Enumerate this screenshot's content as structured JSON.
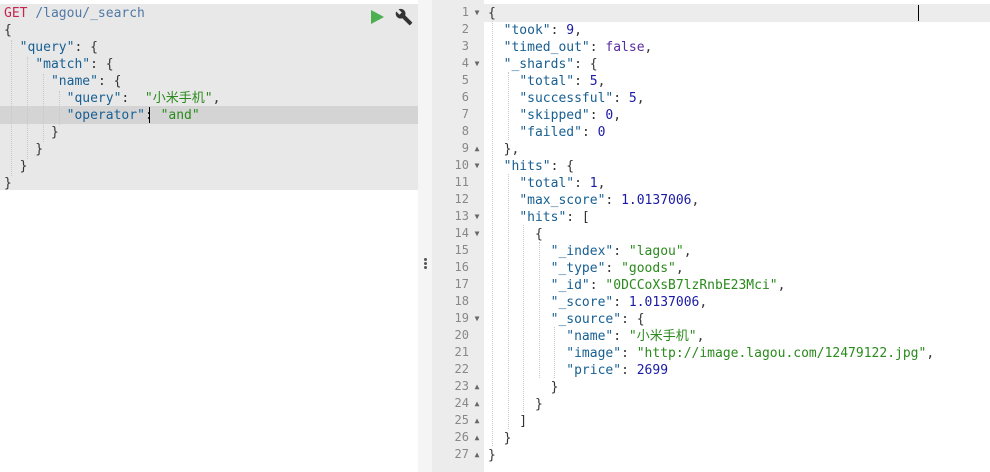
{
  "request": {
    "method": "GET",
    "path": "/lagou/_search",
    "lines": [
      [
        {
          "t": "{"
        }
      ],
      [
        {
          "t": "  "
        },
        {
          "t": "\"query\"",
          "c": "k"
        },
        {
          "t": ": {"
        }
      ],
      [
        {
          "t": "    "
        },
        {
          "t": "\"match\"",
          "c": "k"
        },
        {
          "t": ": {"
        }
      ],
      [
        {
          "t": "      "
        },
        {
          "t": "\"name\"",
          "c": "k"
        },
        {
          "t": ": {"
        }
      ],
      [
        {
          "t": "        "
        },
        {
          "t": "\"query\"",
          "c": "k"
        },
        {
          "t": ":  "
        },
        {
          "t": "\"小米手机\"",
          "c": "s"
        },
        {
          "t": ","
        }
      ],
      [
        {
          "t": "        "
        },
        {
          "t": "\"operator\"",
          "c": "k"
        },
        {
          "t": ": "
        },
        {
          "t": "\"and\"",
          "c": "s"
        }
      ],
      [
        {
          "t": "      }"
        }
      ],
      [
        {
          "t": "    }"
        }
      ],
      [
        {
          "t": "  }"
        }
      ],
      [
        {
          "t": "}"
        }
      ]
    ]
  },
  "toolbar": {
    "run_icon": "play-icon",
    "run_color": "#4caf50",
    "settings_icon": "wrench-icon"
  },
  "response": {
    "line_numbers": [
      "1",
      "2",
      "3",
      "4",
      "5",
      "6",
      "7",
      "8",
      "9",
      "10",
      "11",
      "12",
      "13",
      "14",
      "15",
      "16",
      "17",
      "18",
      "19",
      "20",
      "21",
      "22",
      "23",
      "24",
      "25",
      "26",
      "27"
    ],
    "folds": [
      "down",
      "",
      "",
      "down",
      "",
      "",
      "",
      "",
      "up",
      "down",
      "",
      "",
      "down",
      "down",
      "",
      "",
      "",
      "",
      "down",
      "",
      "",
      "",
      "up",
      "up",
      "up",
      "up",
      "up"
    ],
    "lines": [
      [
        {
          "t": "{"
        }
      ],
      [
        {
          "t": "  "
        },
        {
          "t": "\"took\"",
          "c": "k"
        },
        {
          "t": ": "
        },
        {
          "t": "9",
          "c": "n"
        },
        {
          "t": ","
        }
      ],
      [
        {
          "t": "  "
        },
        {
          "t": "\"timed_out\"",
          "c": "k"
        },
        {
          "t": ": "
        },
        {
          "t": "false",
          "c": "b"
        },
        {
          "t": ","
        }
      ],
      [
        {
          "t": "  "
        },
        {
          "t": "\"_shards\"",
          "c": "k"
        },
        {
          "t": ": {"
        }
      ],
      [
        {
          "t": "    "
        },
        {
          "t": "\"total\"",
          "c": "k"
        },
        {
          "t": ": "
        },
        {
          "t": "5",
          "c": "n"
        },
        {
          "t": ","
        }
      ],
      [
        {
          "t": "    "
        },
        {
          "t": "\"successful\"",
          "c": "k"
        },
        {
          "t": ": "
        },
        {
          "t": "5",
          "c": "n"
        },
        {
          "t": ","
        }
      ],
      [
        {
          "t": "    "
        },
        {
          "t": "\"skipped\"",
          "c": "k"
        },
        {
          "t": ": "
        },
        {
          "t": "0",
          "c": "n"
        },
        {
          "t": ","
        }
      ],
      [
        {
          "t": "    "
        },
        {
          "t": "\"failed\"",
          "c": "k"
        },
        {
          "t": ": "
        },
        {
          "t": "0",
          "c": "n"
        }
      ],
      [
        {
          "t": "  },"
        }
      ],
      [
        {
          "t": "  "
        },
        {
          "t": "\"hits\"",
          "c": "k"
        },
        {
          "t": ": {"
        }
      ],
      [
        {
          "t": "    "
        },
        {
          "t": "\"total\"",
          "c": "k"
        },
        {
          "t": ": "
        },
        {
          "t": "1",
          "c": "n"
        },
        {
          "t": ","
        }
      ],
      [
        {
          "t": "    "
        },
        {
          "t": "\"max_score\"",
          "c": "k"
        },
        {
          "t": ": "
        },
        {
          "t": "1.0137006",
          "c": "n"
        },
        {
          "t": ","
        }
      ],
      [
        {
          "t": "    "
        },
        {
          "t": "\"hits\"",
          "c": "k"
        },
        {
          "t": ": ["
        }
      ],
      [
        {
          "t": "      {"
        }
      ],
      [
        {
          "t": "        "
        },
        {
          "t": "\"_index\"",
          "c": "k"
        },
        {
          "t": ": "
        },
        {
          "t": "\"lagou\"",
          "c": "s"
        },
        {
          "t": ","
        }
      ],
      [
        {
          "t": "        "
        },
        {
          "t": "\"_type\"",
          "c": "k"
        },
        {
          "t": ": "
        },
        {
          "t": "\"goods\"",
          "c": "s"
        },
        {
          "t": ","
        }
      ],
      [
        {
          "t": "        "
        },
        {
          "t": "\"_id\"",
          "c": "k"
        },
        {
          "t": ": "
        },
        {
          "t": "\"0DCCoXsB7lzRnbE23Mci\"",
          "c": "s"
        },
        {
          "t": ","
        }
      ],
      [
        {
          "t": "        "
        },
        {
          "t": "\"_score\"",
          "c": "k"
        },
        {
          "t": ": "
        },
        {
          "t": "1.0137006",
          "c": "n"
        },
        {
          "t": ","
        }
      ],
      [
        {
          "t": "        "
        },
        {
          "t": "\"_source\"",
          "c": "k"
        },
        {
          "t": ": {"
        }
      ],
      [
        {
          "t": "          "
        },
        {
          "t": "\"name\"",
          "c": "k"
        },
        {
          "t": ": "
        },
        {
          "t": "\"小米手机\"",
          "c": "s"
        },
        {
          "t": ","
        }
      ],
      [
        {
          "t": "          "
        },
        {
          "t": "\"image\"",
          "c": "k"
        },
        {
          "t": ": "
        },
        {
          "t": "\"http://image.lagou.com/12479122.jpg\"",
          "c": "s"
        },
        {
          "t": ","
        }
      ],
      [
        {
          "t": "          "
        },
        {
          "t": "\"price\"",
          "c": "k"
        },
        {
          "t": ": "
        },
        {
          "t": "2699",
          "c": "n"
        }
      ],
      [
        {
          "t": "        }"
        }
      ],
      [
        {
          "t": "      }"
        }
      ],
      [
        {
          "t": "    ]"
        }
      ],
      [
        {
          "t": "  }"
        }
      ],
      [
        {
          "t": "}"
        }
      ]
    ]
  }
}
